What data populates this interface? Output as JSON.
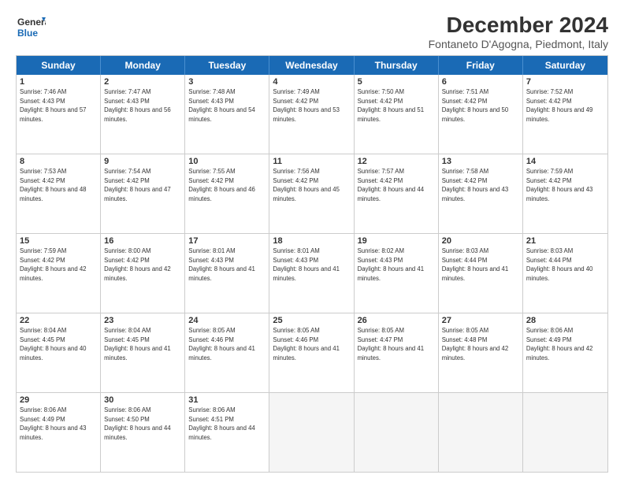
{
  "header": {
    "logo_line1": "General",
    "logo_line2": "Blue",
    "title": "December 2024",
    "subtitle": "Fontaneto D'Agogna, Piedmont, Italy"
  },
  "calendar": {
    "days": [
      "Sunday",
      "Monday",
      "Tuesday",
      "Wednesday",
      "Thursday",
      "Friday",
      "Saturday"
    ],
    "weeks": [
      [
        {
          "day": 1,
          "sunrise": "7:46 AM",
          "sunset": "4:43 PM",
          "daylight": "8 hours and 57 minutes."
        },
        {
          "day": 2,
          "sunrise": "7:47 AM",
          "sunset": "4:43 PM",
          "daylight": "8 hours and 56 minutes."
        },
        {
          "day": 3,
          "sunrise": "7:48 AM",
          "sunset": "4:43 PM",
          "daylight": "8 hours and 54 minutes."
        },
        {
          "day": 4,
          "sunrise": "7:49 AM",
          "sunset": "4:42 PM",
          "daylight": "8 hours and 53 minutes."
        },
        {
          "day": 5,
          "sunrise": "7:50 AM",
          "sunset": "4:42 PM",
          "daylight": "8 hours and 51 minutes."
        },
        {
          "day": 6,
          "sunrise": "7:51 AM",
          "sunset": "4:42 PM",
          "daylight": "8 hours and 50 minutes."
        },
        {
          "day": 7,
          "sunrise": "7:52 AM",
          "sunset": "4:42 PM",
          "daylight": "8 hours and 49 minutes."
        }
      ],
      [
        {
          "day": 8,
          "sunrise": "7:53 AM",
          "sunset": "4:42 PM",
          "daylight": "8 hours and 48 minutes."
        },
        {
          "day": 9,
          "sunrise": "7:54 AM",
          "sunset": "4:42 PM",
          "daylight": "8 hours and 47 minutes."
        },
        {
          "day": 10,
          "sunrise": "7:55 AM",
          "sunset": "4:42 PM",
          "daylight": "8 hours and 46 minutes."
        },
        {
          "day": 11,
          "sunrise": "7:56 AM",
          "sunset": "4:42 PM",
          "daylight": "8 hours and 45 minutes."
        },
        {
          "day": 12,
          "sunrise": "7:57 AM",
          "sunset": "4:42 PM",
          "daylight": "8 hours and 44 minutes."
        },
        {
          "day": 13,
          "sunrise": "7:58 AM",
          "sunset": "4:42 PM",
          "daylight": "8 hours and 43 minutes."
        },
        {
          "day": 14,
          "sunrise": "7:59 AM",
          "sunset": "4:42 PM",
          "daylight": "8 hours and 43 minutes."
        }
      ],
      [
        {
          "day": 15,
          "sunrise": "7:59 AM",
          "sunset": "4:42 PM",
          "daylight": "8 hours and 42 minutes."
        },
        {
          "day": 16,
          "sunrise": "8:00 AM",
          "sunset": "4:42 PM",
          "daylight": "8 hours and 42 minutes."
        },
        {
          "day": 17,
          "sunrise": "8:01 AM",
          "sunset": "4:43 PM",
          "daylight": "8 hours and 41 minutes."
        },
        {
          "day": 18,
          "sunrise": "8:01 AM",
          "sunset": "4:43 PM",
          "daylight": "8 hours and 41 minutes."
        },
        {
          "day": 19,
          "sunrise": "8:02 AM",
          "sunset": "4:43 PM",
          "daylight": "8 hours and 41 minutes."
        },
        {
          "day": 20,
          "sunrise": "8:03 AM",
          "sunset": "4:44 PM",
          "daylight": "8 hours and 41 minutes."
        },
        {
          "day": 21,
          "sunrise": "8:03 AM",
          "sunset": "4:44 PM",
          "daylight": "8 hours and 40 minutes."
        }
      ],
      [
        {
          "day": 22,
          "sunrise": "8:04 AM",
          "sunset": "4:45 PM",
          "daylight": "8 hours and 40 minutes."
        },
        {
          "day": 23,
          "sunrise": "8:04 AM",
          "sunset": "4:45 PM",
          "daylight": "8 hours and 41 minutes."
        },
        {
          "day": 24,
          "sunrise": "8:05 AM",
          "sunset": "4:46 PM",
          "daylight": "8 hours and 41 minutes."
        },
        {
          "day": 25,
          "sunrise": "8:05 AM",
          "sunset": "4:46 PM",
          "daylight": "8 hours and 41 minutes."
        },
        {
          "day": 26,
          "sunrise": "8:05 AM",
          "sunset": "4:47 PM",
          "daylight": "8 hours and 41 minutes."
        },
        {
          "day": 27,
          "sunrise": "8:05 AM",
          "sunset": "4:48 PM",
          "daylight": "8 hours and 42 minutes."
        },
        {
          "day": 28,
          "sunrise": "8:06 AM",
          "sunset": "4:49 PM",
          "daylight": "8 hours and 42 minutes."
        }
      ],
      [
        {
          "day": 29,
          "sunrise": "8:06 AM",
          "sunset": "4:49 PM",
          "daylight": "8 hours and 43 minutes."
        },
        {
          "day": 30,
          "sunrise": "8:06 AM",
          "sunset": "4:50 PM",
          "daylight": "8 hours and 44 minutes."
        },
        {
          "day": 31,
          "sunrise": "8:06 AM",
          "sunset": "4:51 PM",
          "daylight": "8 hours and 44 minutes."
        },
        null,
        null,
        null,
        null
      ]
    ]
  }
}
